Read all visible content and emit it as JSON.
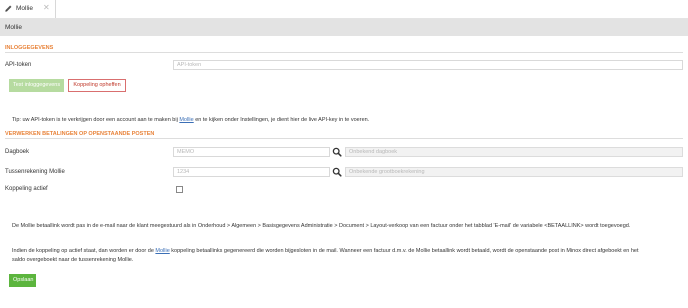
{
  "tab": {
    "title": "Mollie",
    "pencil_icon": "pencil-icon",
    "close_icon": "close-icon"
  },
  "page": {
    "title": "Mollie"
  },
  "login": {
    "section_title": "INLOGGEGEVENS",
    "api_token_label": "API-token",
    "api_token_placeholder": "API-token",
    "api_token_value": "",
    "test_button": "Test inloggegevens",
    "unlink_button": "Koppeling opheffen",
    "tip_before": "Tip: uw API-token is te verkrijgen door een account aan te maken bij ",
    "tip_link": "Mollie",
    "tip_after": " en te kijken onder Instellingen, je dient hier de live API-key in te voeren."
  },
  "processing": {
    "section_title": "VERWERKEN BETALINGEN OP OPENSTAANDE POSTEN",
    "journal_label": "Dagboek",
    "journal_placeholder": "MEMO",
    "journal_description_placeholder": "Onbekend dagboek",
    "interim_label": "Tussenrekening Mollie",
    "interim_placeholder": "1234",
    "interim_description_placeholder": "Onbekende grootboekrekening",
    "active_label": "Koppeling actief",
    "active_checked": false
  },
  "info": {
    "para1": "De Mollie betaallink wordt pas in de e-mail naar de klant meegestuurd als in Onderhoud > Algemeen > Basisgegevens Administratie > Document > Layout-verkoop van een factuur onder het tabblad 'E-mail' de variabele <BETAALLINK> wordt toegevoegd.",
    "para2_before": "Indien de koppeling op actief staat, dan worden er door de ",
    "para2_link": "Mollie",
    "para2_after": " koppeling betaallinks gegenereerd die worden bijgesloten in de mail. Wanneer een factuur d.m.v. de Mollie betaallink wordt betaald, wordt de openstaande post in Minox direct afgeboekt en het",
    "para2_line2": "saldo overgeboekt naar de tussenrekening Mollie."
  },
  "footer": {
    "save_button": "Opslaan"
  },
  "colors": {
    "accent": "#e8833a",
    "save_green": "#5cb53e",
    "danger": "#c0392b",
    "link": "#3b6fb6"
  }
}
